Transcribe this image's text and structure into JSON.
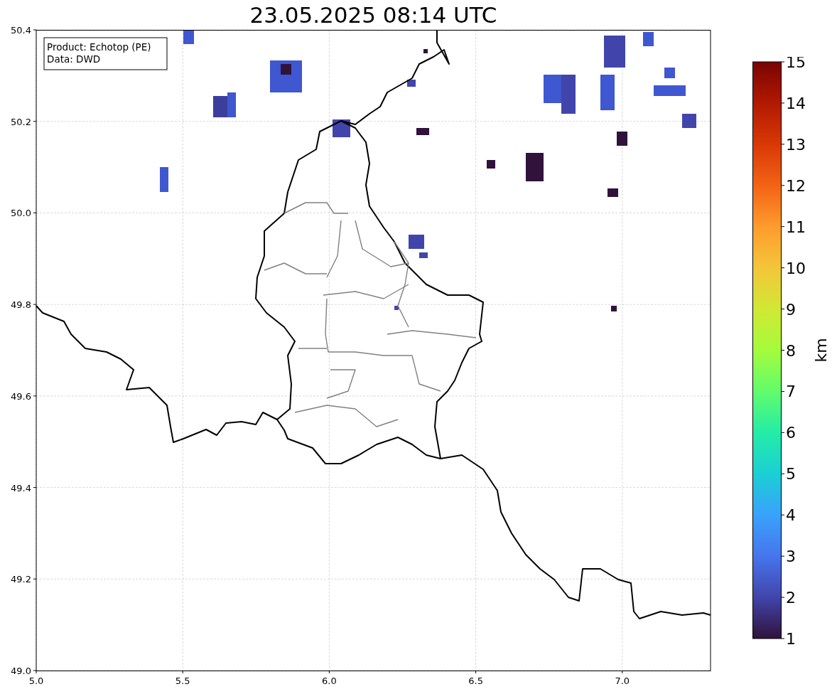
{
  "title": "23.05.2025 08:14 UTC",
  "legend": [
    "Product: Echotop (PE)",
    "Data: DWD"
  ],
  "x_ticks": [
    "5.0",
    "5.5",
    "6.0",
    "6.5",
    "7.0"
  ],
  "y_ticks": [
    "50.4",
    "50.2",
    "50.0",
    "49.8",
    "49.6",
    "49.4",
    "49.2",
    "49.0"
  ],
  "colorbar": {
    "label": "km",
    "ticks": [
      "15",
      "14",
      "13",
      "12",
      "11",
      "10",
      "9",
      "8",
      "7",
      "6",
      "5",
      "4",
      "3",
      "2",
      "1"
    ]
  }
}
